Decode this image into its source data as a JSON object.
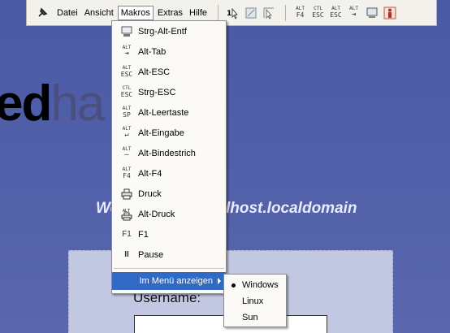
{
  "toolbar": {
    "menus": {
      "datei": "Datei",
      "ansicht": "Ansicht",
      "makros": "Makros",
      "extras": "Extras",
      "hilfe": "Hilfe"
    },
    "buttons": {
      "alt_f4": [
        "ALT",
        "F4"
      ],
      "ctl_esc": [
        "CTL",
        "ESC"
      ],
      "alt_esc": [
        "ALT",
        "ESC"
      ],
      "alt_tab": [
        "ALT",
        "⇥"
      ]
    }
  },
  "makros_menu": {
    "items": [
      {
        "label": "Strg-Alt-Entf",
        "icon": "monitor-icon"
      },
      {
        "label": "Alt-Tab",
        "icon_text": [
          "ALT",
          "⇥"
        ]
      },
      {
        "label": "Alt-ESC",
        "icon_text": [
          "ALT",
          "ESC"
        ]
      },
      {
        "label": "Strg-ESC",
        "icon_text": [
          "CTL",
          "ESC"
        ]
      },
      {
        "label": "Alt-Leertaste",
        "icon_text": [
          "ALT",
          "SP"
        ]
      },
      {
        "label": "Alt-Eingabe",
        "icon_text": [
          "ALT",
          "↵"
        ]
      },
      {
        "label": "Alt-Bindestrich",
        "icon_text": [
          "ALT",
          "—"
        ]
      },
      {
        "label": "Alt-F4",
        "icon_text": [
          "ALT",
          "F4"
        ]
      },
      {
        "label": "Druck",
        "icon": "printer-icon"
      },
      {
        "label": "Alt-Druck",
        "icon": "alt-printer-icon"
      },
      {
        "label": "F1",
        "icon_text": [
          "F1"
        ]
      },
      {
        "label": "Pause",
        "icon_text": [
          "II"
        ]
      }
    ],
    "show_in_menu": "Im Menü anzeigen"
  },
  "submenu": {
    "items": [
      "Windows",
      "Linux",
      "Sun"
    ],
    "selected": "Windows"
  },
  "background": {
    "brand_bold": "ed",
    "brand_light": "ha",
    "welcome_left": "We",
    "welcome_right": "lhost.localdomain",
    "username_label": "Username:"
  },
  "colors": {
    "highlight": "#316ac5",
    "desktop": "#4a5aa4",
    "toolbar": "#f2f1ec"
  }
}
